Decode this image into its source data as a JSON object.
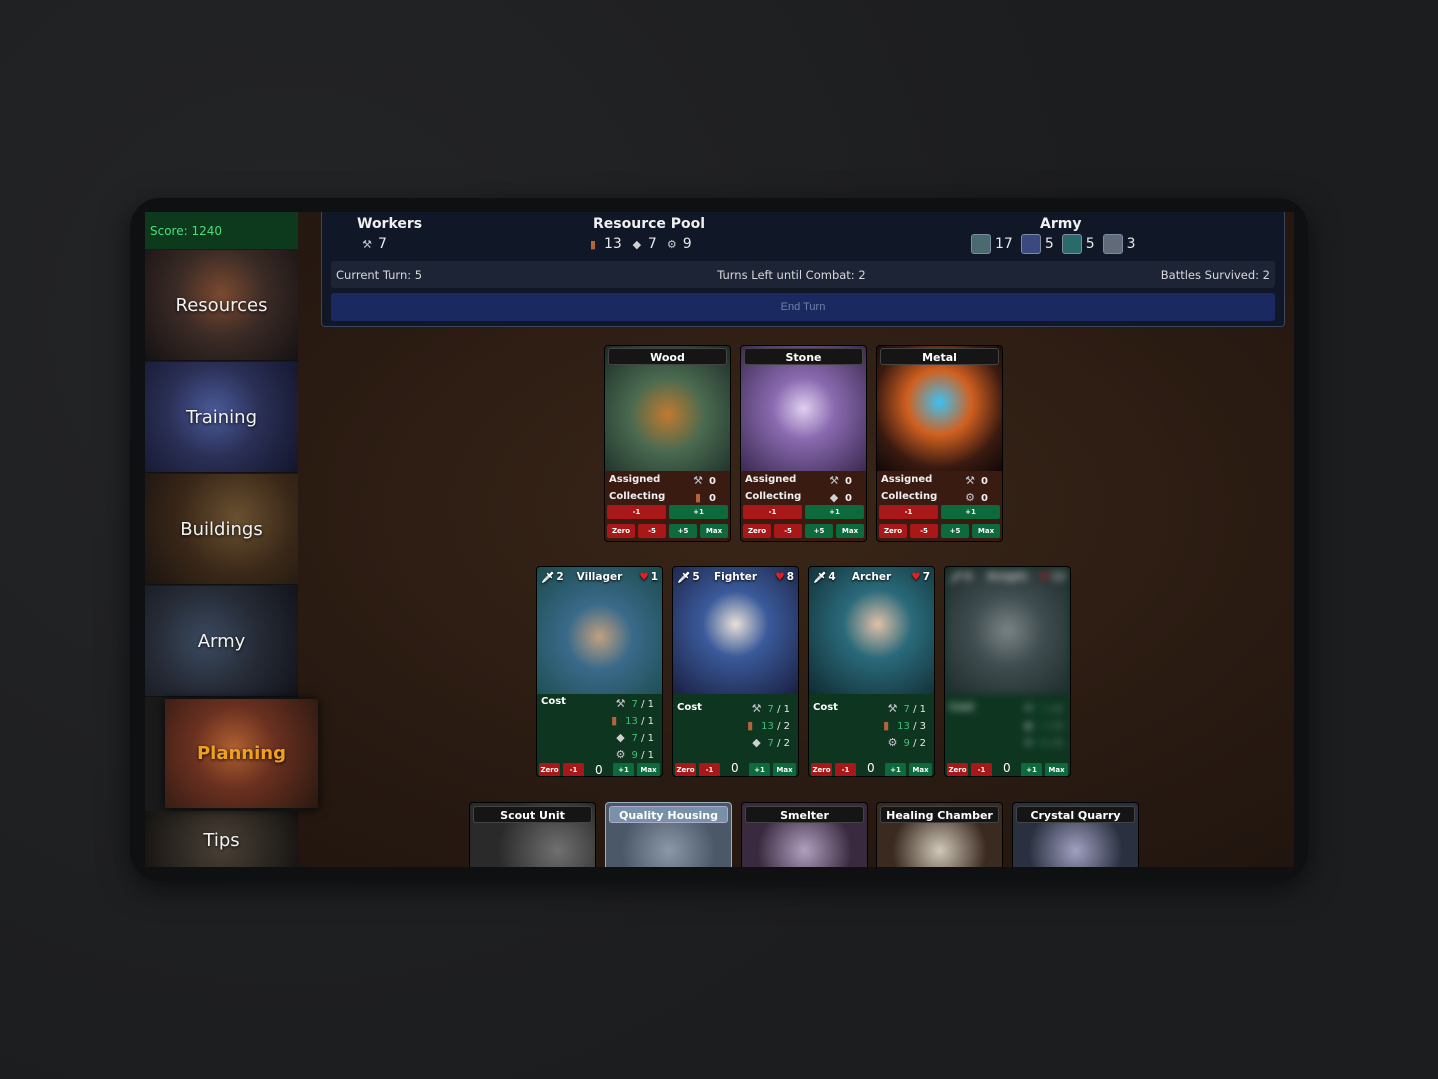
{
  "score": "Score: 1240",
  "nav": [
    "Resources",
    "Training",
    "Buildings",
    "Army",
    "Planning",
    "Tips"
  ],
  "workers": {
    "label": "Workers",
    "value": "7"
  },
  "pool": {
    "label": "Resource Pool",
    "wood": "13",
    "stone": "7",
    "metal": "9"
  },
  "army": {
    "label": "Army",
    "values": [
      "17",
      "5",
      "5",
      "3"
    ]
  },
  "turn": {
    "current": "Current Turn: 5",
    "until": "Turns Left until Combat: 2",
    "battles": "Battles Survived: 2",
    "end": "End Turn"
  },
  "resources": [
    {
      "name": "Wood",
      "assigned_label": "Assigned",
      "collecting_label": "Collecting",
      "assigned": "0",
      "collecting": "0"
    },
    {
      "name": "Stone",
      "assigned_label": "Assigned",
      "collecting_label": "Collecting",
      "assigned": "0",
      "collecting": "0"
    },
    {
      "name": "Metal",
      "assigned_label": "Assigned",
      "collecting_label": "Collecting",
      "assigned": "0",
      "collecting": "0"
    }
  ],
  "buttons": {
    "minus1": "-1",
    "plus1": "+1",
    "zero": "Zero",
    "minus5": "-5",
    "plus5": "+5",
    "max": "Max"
  },
  "units": [
    {
      "name": "Villager",
      "atk": "2",
      "hp": "1",
      "cost_label": "Cost",
      "costs": [
        [
          "7",
          "1"
        ],
        [
          "13",
          "1"
        ],
        [
          "7",
          "1"
        ],
        [
          "9",
          "1"
        ]
      ],
      "count": "0"
    },
    {
      "name": "Fighter",
      "atk": "5",
      "hp": "8",
      "cost_label": "Cost",
      "costs": [
        [
          "7",
          "1"
        ],
        [
          "13",
          "2"
        ],
        [
          "7",
          "2"
        ]
      ],
      "count": "0"
    },
    {
      "name": "Archer",
      "atk": "4",
      "hp": "7",
      "cost_label": "Cost",
      "costs": [
        [
          "7",
          "1"
        ],
        [
          "13",
          "3"
        ],
        [
          "9",
          "2"
        ]
      ],
      "count": "0"
    },
    {
      "name": "Knight",
      "atk": "8",
      "hp": "12",
      "cost_label": "Cost",
      "costs": [
        [
          "7",
          "2"
        ],
        [
          "7",
          "3"
        ],
        [
          "9",
          "3"
        ]
      ],
      "count": "0"
    }
  ],
  "buildings": [
    "Scout Unit",
    "Quality Housing",
    "Smelter",
    "Healing Chamber",
    "Crystal Quarry"
  ]
}
